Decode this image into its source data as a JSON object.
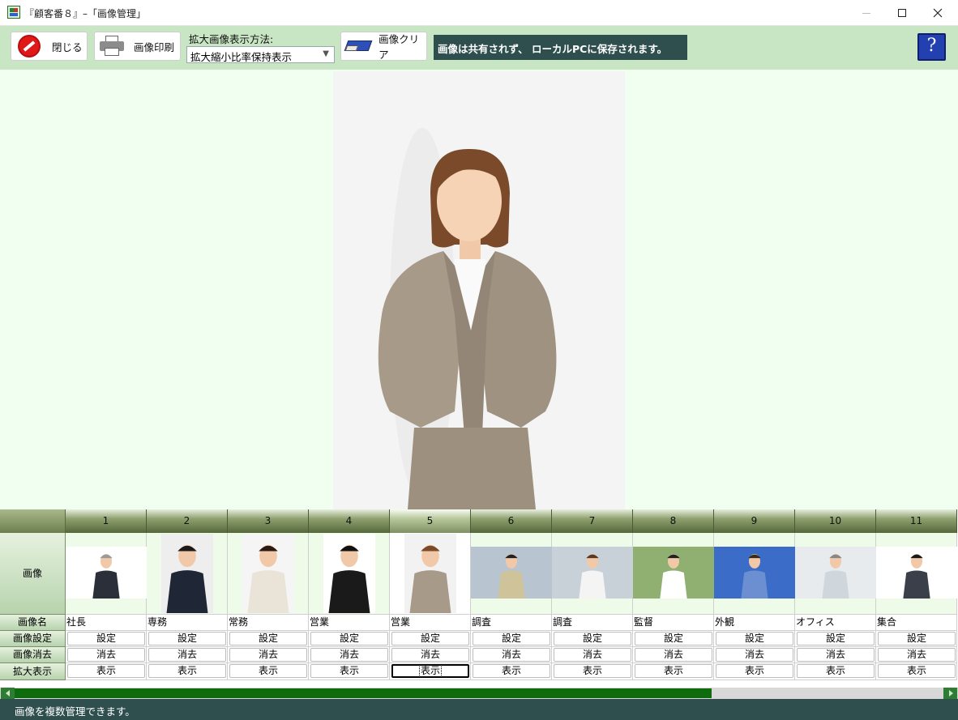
{
  "window": {
    "title": "『顧客番８』–「画像管理」"
  },
  "toolbar": {
    "close_label": "閉じる",
    "print_label": "画像印刷",
    "display_mode_label": "拡大画像表示方法:",
    "display_mode_value": "拡大縮小比率保持表示",
    "clear_label": "画像クリア",
    "notice": "画像は共有されず、 ローカルPCに保存されます。",
    "help_label": "?"
  },
  "grid": {
    "row_labels": {
      "image": "画像",
      "name": "画像名",
      "set": "画像設定",
      "delete": "画像消去",
      "zoom": "拡大表示"
    },
    "selected_column": 5,
    "columns": [
      {
        "num": "1",
        "name": "社長",
        "set": "設定",
        "delete": "消去",
        "zoom": "表示"
      },
      {
        "num": "2",
        "name": "専務",
        "set": "設定",
        "delete": "消去",
        "zoom": "表示"
      },
      {
        "num": "3",
        "name": "常務",
        "set": "設定",
        "delete": "消去",
        "zoom": "表示"
      },
      {
        "num": "4",
        "name": "営業",
        "set": "設定",
        "delete": "消去",
        "zoom": "表示"
      },
      {
        "num": "5",
        "name": "営業",
        "set": "設定",
        "delete": "消去",
        "zoom": "表示"
      },
      {
        "num": "6",
        "name": "調査",
        "set": "設定",
        "delete": "消去",
        "zoom": "表示"
      },
      {
        "num": "7",
        "name": "調査",
        "set": "設定",
        "delete": "消去",
        "zoom": "表示"
      },
      {
        "num": "8",
        "name": "監督",
        "set": "設定",
        "delete": "消去",
        "zoom": "表示"
      },
      {
        "num": "9",
        "name": "外観",
        "set": "設定",
        "delete": "消去",
        "zoom": "表示"
      },
      {
        "num": "10",
        "name": "オフィス",
        "set": "設定",
        "delete": "消去",
        "zoom": "表示"
      },
      {
        "num": "11",
        "name": "集合",
        "set": "設定",
        "delete": "消去",
        "zoom": "表示"
      }
    ]
  },
  "status": {
    "text": "画像を複数管理できます。"
  }
}
